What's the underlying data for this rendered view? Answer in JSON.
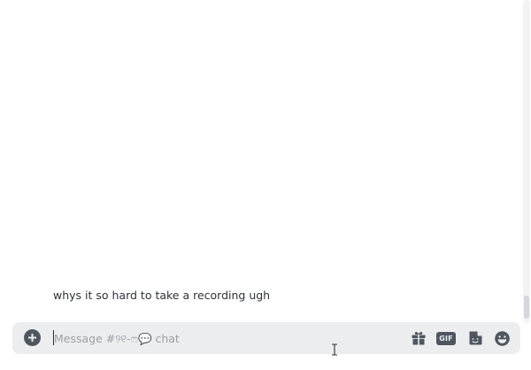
{
  "message": {
    "text": "whys it so hard to take a recording ugh"
  },
  "composer": {
    "placeholder": "Message #୨୧-ෆ💬 chat",
    "value": ""
  },
  "icons": {
    "attach": "plus-circle-icon",
    "gift": "gift-icon",
    "gif": "gif-icon",
    "sticker": "sticker-icon",
    "emoji": "emoji-icon"
  },
  "labels": {
    "gif": "GIF"
  },
  "colors": {
    "icon": "#4f5660",
    "composer_bg": "#ebedef",
    "text": "#2e3338",
    "placeholder": "#9ca0a6"
  }
}
